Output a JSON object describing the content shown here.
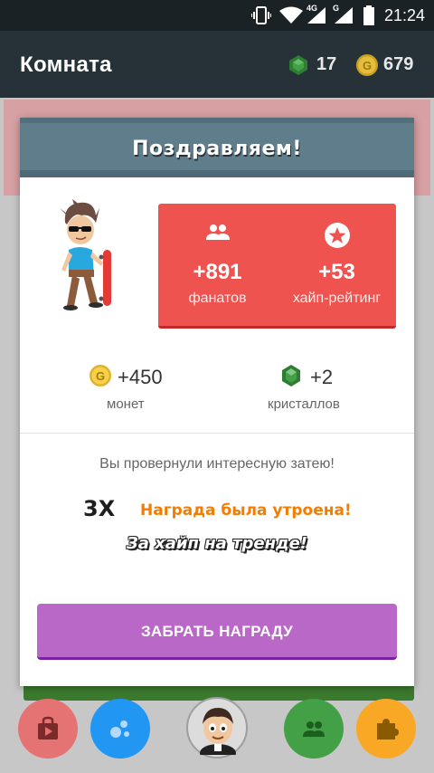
{
  "status_bar": {
    "time": "21:24",
    "network_1": "4G",
    "network_2": "G"
  },
  "app_bar": {
    "title": "Комната",
    "crystals": "17",
    "coins": "679"
  },
  "dialog": {
    "title": "Поздравляем!",
    "stats": [
      {
        "value": "+891",
        "label": "фанатов",
        "icon": "people-icon"
      },
      {
        "value": "+53",
        "label": "хайп-рейтинг",
        "icon": "star-badge-icon"
      }
    ],
    "rewards": [
      {
        "value": "+450",
        "label": "монет",
        "icon": "coin-icon"
      },
      {
        "value": "+2",
        "label": "кристаллов",
        "icon": "crystal-icon"
      }
    ],
    "message": "Вы провернули интересную затею!",
    "multiplier": "3X",
    "multiplier_text": "Награда была утроена!",
    "trend_text": "За хайп на тренде!",
    "claim_button": "ЗАБРАТЬ НАГРАДУ"
  },
  "bottom_nav": [
    {
      "name": "shop",
      "icon": "shopping-bag-icon",
      "color": "#e57373"
    },
    {
      "name": "bubbles",
      "icon": "bubbles-icon",
      "color": "#2196f3"
    },
    {
      "name": "profile",
      "icon": "avatar",
      "color": "#e0e0e0"
    },
    {
      "name": "friends",
      "icon": "people-icon",
      "color": "#43a047"
    },
    {
      "name": "extensions",
      "icon": "puzzle-icon",
      "color": "#f9a825"
    }
  ],
  "colors": {
    "header": "#263238",
    "dialog_header": "#607d8b",
    "stats_box": "#ef5350",
    "claim_button": "#ba68c8",
    "tripled_text": "#f57c00"
  }
}
